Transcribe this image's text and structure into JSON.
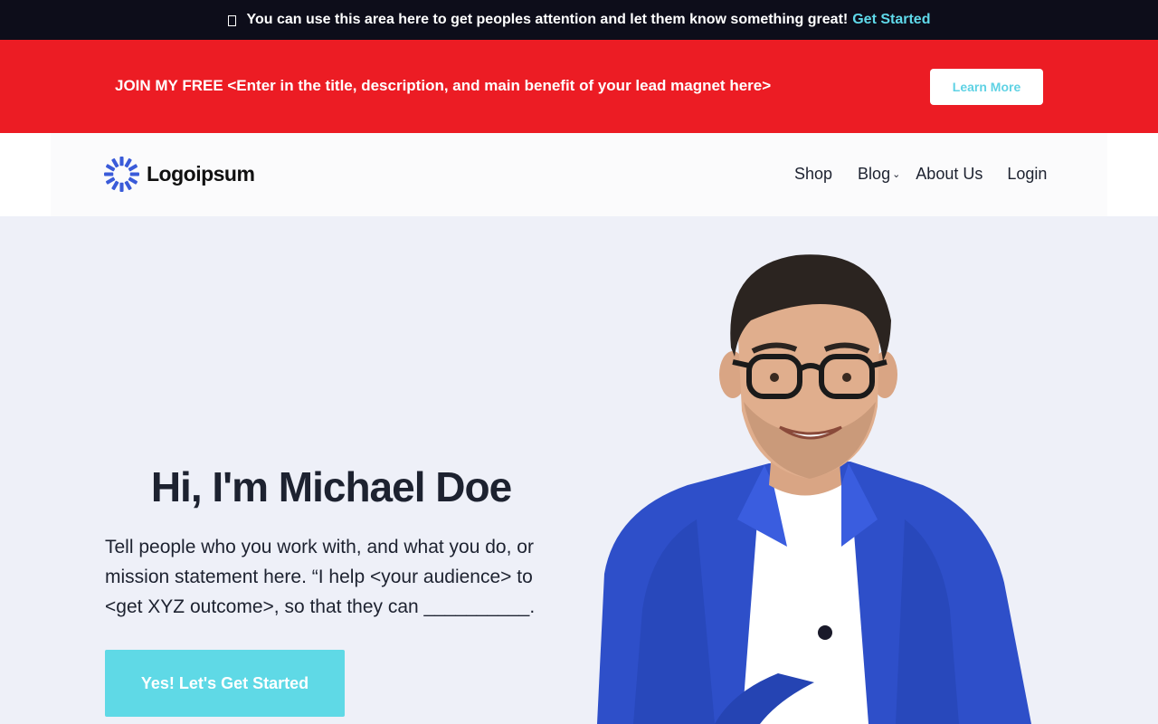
{
  "topbar": {
    "text": "You can use this area here to get peoples attention and let them know something great!",
    "link_label": "Get Started",
    "icon": "box-icon"
  },
  "leadbar": {
    "text": "JOIN MY FREE <Enter in the title, description, and main benefit of your lead magnet here>",
    "button_label": "Learn More"
  },
  "header": {
    "logo_text": "Logoipsum",
    "nav": [
      {
        "label": "Shop"
      },
      {
        "label": "Blog"
      },
      {
        "label": "About Us"
      },
      {
        "label": "Login"
      }
    ]
  },
  "hero": {
    "title": "Hi, I'm Michael Doe",
    "description": "Tell people who you work with, and what you do, or mission statement here. “I help <your audience> to <get XYZ outcome>, so that they can __________.",
    "button_label": "Yes! Let's Get Started"
  },
  "colors": {
    "topbar_bg": "#0d0d1a",
    "accent_cyan": "#5fd9e6",
    "lead_red": "#ec1c24",
    "hero_bg": "#eef0f8",
    "logo_blue": "#3a5bd9",
    "jacket_blue": "#2e4fc9"
  }
}
